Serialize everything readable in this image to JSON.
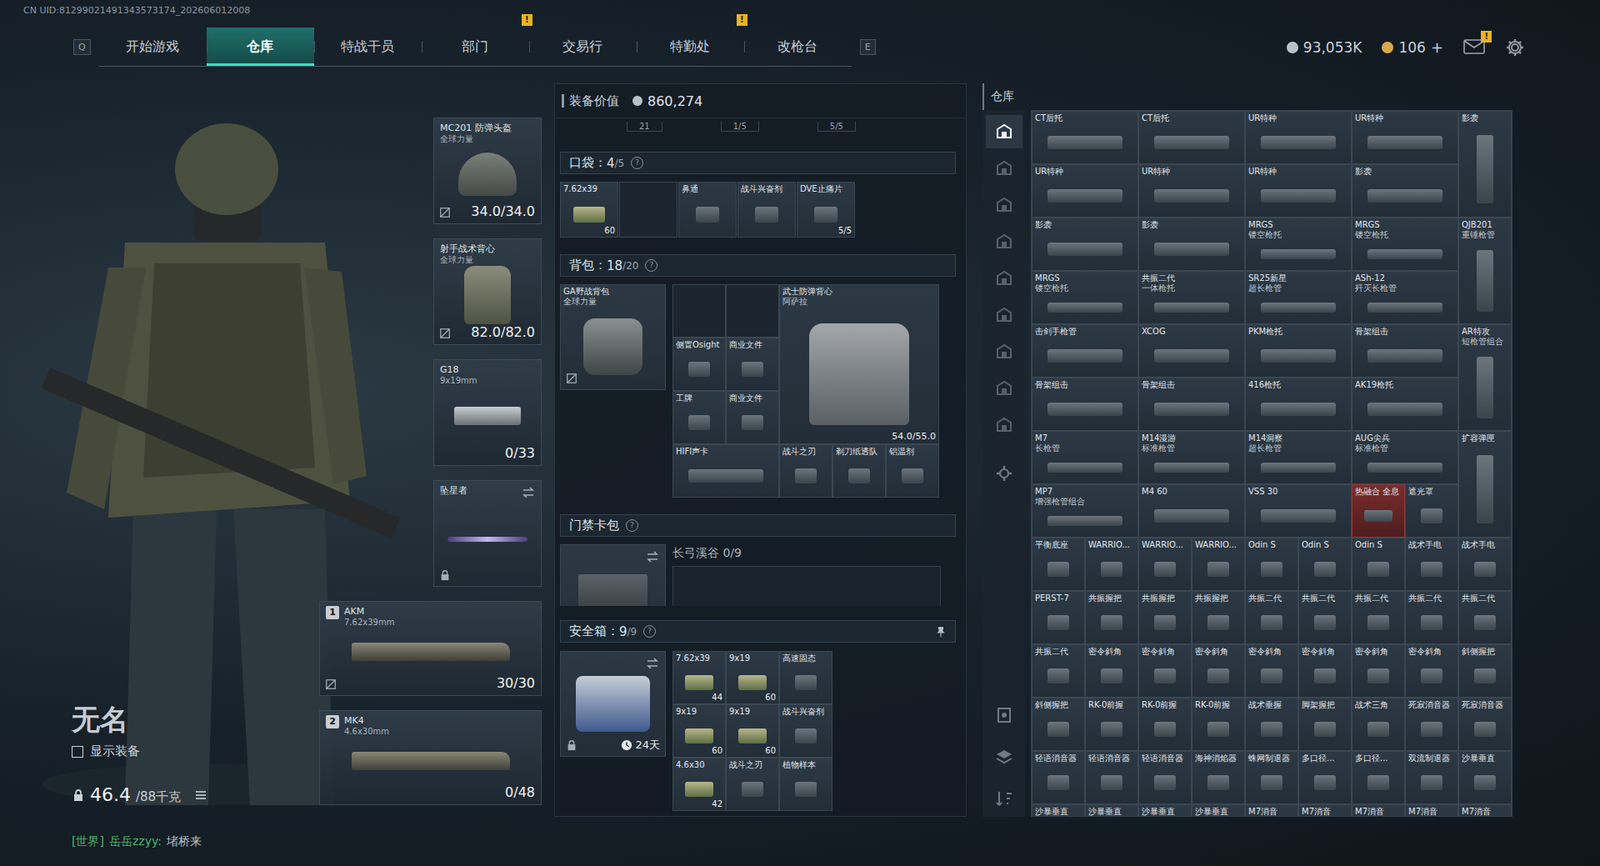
{
  "uid": "CN UID:81299021491343573174_202606012008",
  "alert_mark": "!",
  "nav": {
    "prev_key": "Q",
    "next_key": "E",
    "tabs": [
      {
        "label": "开始游戏",
        "selected": false,
        "badge": false
      },
      {
        "label": "仓库",
        "selected": true,
        "badge": false
      },
      {
        "label": "特战干员",
        "selected": false,
        "badge": false
      },
      {
        "label": "部门",
        "selected": false,
        "badge": true
      },
      {
        "label": "交易行",
        "selected": false,
        "badge": false
      },
      {
        "label": "特勤处",
        "selected": false,
        "badge": true
      },
      {
        "label": "改枪台",
        "selected": false,
        "badge": false
      }
    ]
  },
  "currencies": [
    {
      "amount": "93,053K",
      "plus": "",
      "color": "#b9c2c9"
    },
    {
      "amount": "106",
      "plus": "+",
      "color": "#d8a84a"
    }
  ],
  "mail": {
    "badge": true
  },
  "character": {
    "name": "无名",
    "show_equipment": {
      "label": "显示装备",
      "checked": false
    },
    "weight": {
      "value": "46.4",
      "max": "/88千克"
    }
  },
  "gear_slots": [
    {
      "name": "MC201 防弹头盔",
      "sub": "全球力量",
      "reading": "34.0/34.0",
      "kind": "helmet",
      "marked": true,
      "locked": false,
      "swap": false
    },
    {
      "name": "射手战术背心",
      "sub": "全球力量",
      "reading": "82.0/82.0",
      "kind": "vest",
      "marked": true,
      "locked": false,
      "swap": false
    },
    {
      "name": "G18",
      "sub": "9x19mm",
      "reading": "0/33",
      "kind": "pistol",
      "marked": false,
      "locked": false,
      "swap": false
    },
    {
      "name": "坠星者",
      "sub": "",
      "reading": "",
      "kind": "melee",
      "marked": false,
      "locked": true,
      "swap": true
    }
  ],
  "weapons": [
    {
      "index": "1",
      "name": "AKM",
      "caliber": "7.62x39mm",
      "ammo": "30/30",
      "marked": true
    },
    {
      "index": "2",
      "name": "MK4",
      "caliber": "4.6x30mm",
      "ammo": "0/48",
      "marked": false
    }
  ],
  "equipment_value": {
    "label": "装备价值",
    "value": "860,274"
  },
  "cut_row": [
    "21",
    "1/5",
    "5/5"
  ],
  "pockets": {
    "title": "口袋：",
    "count": "4",
    "capacity": "/5",
    "help": "?",
    "items": [
      {
        "name": "7.62x39",
        "sub": "",
        "count": "60",
        "kind": "ammo"
      },
      {
        "name": "",
        "sub": "",
        "count": "",
        "kind": "empty"
      },
      {
        "name": "鼻通",
        "sub": "",
        "count": "",
        "kind": "item"
      },
      {
        "name": "战斗兴奋剂",
        "sub": "",
        "count": "",
        "kind": "item"
      },
      {
        "name": "DVE止痛片",
        "sub": "",
        "count": "5/5",
        "kind": "item"
      }
    ]
  },
  "backpack": {
    "title": "背包：",
    "count": "18",
    "capacity": "/20",
    "help": "?",
    "bag": {
      "name": "GA野战背包",
      "sub": "全球力量",
      "marked": true
    },
    "items": [
      {
        "name": "",
        "sub": "",
        "count": "",
        "kind": "empty"
      },
      {
        "name": "",
        "sub": "",
        "count": "",
        "kind": "empty"
      },
      {
        "name": "武士防弹背心",
        "sub": "阿萨拉",
        "count": "54.0/55.0",
        "kind": "big"
      },
      {
        "name": "侧置Osight",
        "sub": "",
        "count": "",
        "kind": "one"
      },
      {
        "name": "商业文件",
        "sub": "",
        "count": "",
        "kind": "one"
      },
      {
        "name": "工牌",
        "sub": "",
        "count": "",
        "kind": "one"
      },
      {
        "name": "商业文件",
        "sub": "",
        "count": "",
        "kind": "one"
      },
      {
        "name": "HIFI声卡",
        "sub": "",
        "count": "",
        "kind": "wide"
      },
      {
        "name": "战斗之刃",
        "sub": "",
        "count": "",
        "kind": "one"
      },
      {
        "name": "剃刀纸透队",
        "sub": "",
        "count": "",
        "kind": "one"
      },
      {
        "name": "铝温剂",
        "sub": "",
        "count": "",
        "kind": "one"
      }
    ]
  },
  "card_pack": {
    "title": "门禁卡包",
    "help": "?",
    "map": "长弓溪谷",
    "count": "0/9"
  },
  "safe_box": {
    "title": "安全箱：",
    "count": "9",
    "capacity": "/9",
    "help": "?",
    "timer": "24天",
    "items": [
      {
        "name": "7.62x39",
        "sub": "",
        "count": "44",
        "kind": "ammo"
      },
      {
        "name": "9x19",
        "sub": "",
        "count": "60",
        "kind": "ammo"
      },
      {
        "name": "高速固态",
        "sub": "",
        "count": "",
        "kind": "item"
      },
      {
        "name": "9x19",
        "sub": "",
        "count": "60",
        "kind": "ammo"
      },
      {
        "name": "9x19",
        "sub": "",
        "count": "60",
        "kind": "ammo"
      },
      {
        "name": "战斗兴奋剂",
        "sub": "",
        "count": "",
        "kind": "item"
      },
      {
        "name": "4.6x30",
        "sub": "",
        "count": "42",
        "kind": "ammo"
      },
      {
        "name": "战斗之刃",
        "sub": "",
        "count": "",
        "kind": "item"
      },
      {
        "name": "植物样本",
        "sub": "",
        "count": "",
        "kind": "item"
      }
    ]
  },
  "warehouse": {
    "title": "仓库",
    "tabs": [
      {
        "selected": true
      },
      {
        "selected": false
      },
      {
        "selected": false
      },
      {
        "selected": false
      },
      {
        "selected": false
      },
      {
        "selected": false
      },
      {
        "selected": false
      },
      {
        "selected": false
      },
      {
        "selected": false
      }
    ],
    "items": [
      {
        "name": "CT后托",
        "sub": "",
        "kind": "wide"
      },
      {
        "name": "CT后托",
        "sub": "",
        "kind": "wide"
      },
      {
        "name": "UR特种",
        "sub": "",
        "kind": "wide"
      },
      {
        "name": "UR特种",
        "sub": "",
        "kind": "wide"
      },
      {
        "name": "影袭",
        "sub": "",
        "kind": "tall"
      },
      {
        "name": "UR特种",
        "sub": "",
        "kind": "wide"
      },
      {
        "name": "UR特种",
        "sub": "",
        "kind": "wide"
      },
      {
        "name": "UR特种",
        "sub": "",
        "kind": "wide"
      },
      {
        "name": "影袭",
        "sub": "",
        "kind": "wide"
      },
      {
        "name": "影袭",
        "sub": "",
        "kind": "wide"
      },
      {
        "name": "影袭",
        "sub": "",
        "kind": "wide"
      },
      {
        "name": "MRGS",
        "sub": "镂空枪托",
        "kind": "wide"
      },
      {
        "name": "MRGS",
        "sub": "镂空枪托",
        "kind": "wide"
      },
      {
        "name": "QJB201",
        "sub": "重锤枪管",
        "kind": "tall"
      },
      {
        "name": "MRGS",
        "sub": "镂空枪托",
        "kind": "wide"
      },
      {
        "name": "共振二代",
        "sub": "一体枪托",
        "kind": "wide"
      },
      {
        "name": "SR25新星",
        "sub": "超长枪管",
        "kind": "wide"
      },
      {
        "name": "ASh-12",
        "sub": "歼灭长枪管",
        "kind": "wide"
      },
      {
        "name": "击剑手枪管",
        "sub": "",
        "kind": "wide"
      },
      {
        "name": "XCOG",
        "sub": "",
        "kind": "wide"
      },
      {
        "name": "PKM枪托",
        "sub": "",
        "kind": "wide"
      },
      {
        "name": "骨架组击",
        "sub": "",
        "kind": "wide"
      },
      {
        "name": "AR特攻",
        "sub": "短枪管组合",
        "kind": "tall"
      },
      {
        "name": "骨架组击",
        "sub": "",
        "kind": "wide"
      },
      {
        "name": "骨架组击",
        "sub": "",
        "kind": "wide"
      },
      {
        "name": "416枪托",
        "sub": "",
        "kind": "wide"
      },
      {
        "name": "AK19枪托",
        "sub": "",
        "kind": "wide"
      },
      {
        "name": "M7",
        "sub": "长枪管",
        "kind": "wide"
      },
      {
        "name": "M14漫游",
        "sub": "标准枪管",
        "kind": "wide"
      },
      {
        "name": "M14洞察",
        "sub": "超长枪管",
        "kind": "wide"
      },
      {
        "name": "AUG尖兵",
        "sub": "标准枪管",
        "kind": "wide"
      },
      {
        "name": "扩容弹匣",
        "sub": "",
        "kind": "tall"
      },
      {
        "name": "MP7",
        "sub": "增强枪管组合",
        "kind": "wide"
      },
      {
        "name": "M4 60",
        "sub": "",
        "kind": "wide"
      },
      {
        "name": "VSS 30",
        "sub": "",
        "kind": "wide"
      },
      {
        "name": "热融合 全息",
        "sub": "",
        "kind": "alert"
      },
      {
        "name": "遮光罩",
        "sub": "",
        "kind": "one"
      },
      {
        "name": "平衡底座",
        "sub": "",
        "kind": "one"
      },
      {
        "name": "WARRIO...",
        "sub": "",
        "kind": "one"
      },
      {
        "name": "WARRIO...",
        "sub": "",
        "kind": "one"
      },
      {
        "name": "WARRIO...",
        "sub": "",
        "kind": "one"
      },
      {
        "name": "Odin S",
        "sub": "",
        "kind": "one"
      },
      {
        "name": "Odin S",
        "sub": "",
        "kind": "one"
      },
      {
        "name": "Odin S",
        "sub": "",
        "kind": "one"
      },
      {
        "name": "战术手电",
        "sub": "",
        "kind": "one"
      },
      {
        "name": "战术手电",
        "sub": "",
        "kind": "one"
      },
      {
        "name": "PERST-7",
        "sub": "",
        "kind": "one"
      },
      {
        "name": "共振握把",
        "sub": "",
        "kind": "one"
      },
      {
        "name": "共振握把",
        "sub": "",
        "kind": "one"
      },
      {
        "name": "共振握把",
        "sub": "",
        "kind": "one"
      },
      {
        "name": "共振二代",
        "sub": "",
        "kind": "one"
      },
      {
        "name": "共振二代",
        "sub": "",
        "kind": "one"
      },
      {
        "name": "共振二代",
        "sub": "",
        "kind": "one"
      },
      {
        "name": "共振二代",
        "sub": "",
        "kind": "one"
      },
      {
        "name": "共振二代",
        "sub": "",
        "kind": "one"
      },
      {
        "name": "共振二代",
        "sub": "",
        "kind": "one"
      },
      {
        "name": "密令斜角",
        "sub": "",
        "kind": "one"
      },
      {
        "name": "密令斜角",
        "sub": "",
        "kind": "one"
      },
      {
        "name": "密令斜角",
        "sub": "",
        "kind": "one"
      },
      {
        "name": "密令斜角",
        "sub": "",
        "kind": "one"
      },
      {
        "name": "密令斜角",
        "sub": "",
        "kind": "one"
      },
      {
        "name": "密令斜角",
        "sub": "",
        "kind": "one"
      },
      {
        "name": "密令斜角",
        "sub": "",
        "kind": "one"
      },
      {
        "name": "斜侧握把",
        "sub": "",
        "kind": "one"
      },
      {
        "name": "斜侧握把",
        "sub": "",
        "kind": "one"
      },
      {
        "name": "RK-0前握",
        "sub": "",
        "kind": "one"
      },
      {
        "name": "RK-0前握",
        "sub": "",
        "kind": "one"
      },
      {
        "name": "RK-0前握",
        "sub": "",
        "kind": "one"
      },
      {
        "name": "战术垂握",
        "sub": "",
        "kind": "one"
      },
      {
        "name": "脚架握把",
        "sub": "",
        "kind": "one"
      },
      {
        "name": "战术三角",
        "sub": "",
        "kind": "one"
      },
      {
        "name": "死寂消音器",
        "sub": "",
        "kind": "one"
      },
      {
        "name": "死寂消音器",
        "sub": "",
        "kind": "one"
      },
      {
        "name": "轻语消音器",
        "sub": "",
        "kind": "one"
      },
      {
        "name": "轻语消音器",
        "sub": "",
        "kind": "one"
      },
      {
        "name": "轻语消音器",
        "sub": "",
        "kind": "one"
      },
      {
        "name": "海神消焰器",
        "sub": "",
        "kind": "one"
      },
      {
        "name": "蛛网制退器",
        "sub": "",
        "kind": "one"
      },
      {
        "name": "多口径...",
        "sub": "",
        "kind": "one"
      },
      {
        "name": "多口径...",
        "sub": "",
        "kind": "one"
      },
      {
        "name": "双流制退器",
        "sub": "",
        "kind": "one"
      },
      {
        "name": "沙暴垂直",
        "sub": "",
        "kind": "one"
      },
      {
        "name": "沙暴垂直",
        "sub": "",
        "kind": "one"
      },
      {
        "name": "沙暴垂直",
        "sub": "",
        "kind": "one"
      },
      {
        "name": "沙暴垂直",
        "sub": "",
        "kind": "one"
      },
      {
        "name": "沙暴垂直",
        "sub": "",
        "kind": "one"
      },
      {
        "name": "M7消音",
        "sub": "",
        "kind": "one"
      },
      {
        "name": "M7消音",
        "sub": "",
        "kind": "one"
      },
      {
        "name": "M7消音",
        "sub": "",
        "kind": "one"
      },
      {
        "name": "M7消音",
        "sub": "",
        "kind": "one"
      },
      {
        "name": "M7消音",
        "sub": "",
        "kind": "one"
      }
    ]
  },
  "chat": {
    "channel": "[世界]",
    "sender": "岳岳zzyy:",
    "message": "堵桥来"
  }
}
